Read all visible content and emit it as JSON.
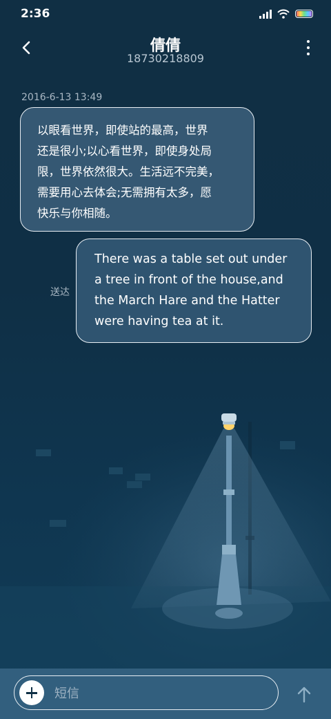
{
  "status_bar": {
    "time": "2:36",
    "icons": [
      "signal-icon",
      "wifi-icon",
      "battery-icon"
    ]
  },
  "header": {
    "back_icon": "chevron-left-icon",
    "contact_name": "倩倩",
    "contact_number": "18730218809",
    "menu_icon": "more-vertical-icon"
  },
  "conversation": {
    "timestamp": "2016-6-13 13:49",
    "messages": [
      {
        "direction": "incoming",
        "lines": [
          "以眼看世界，即使站的最高，世界",
          "还是很小;以心看世界，即使身处局",
          "限，世界依然很大。生活远不完美，",
          "需要用心去体会;无需拥有太多，愿",
          "快乐与你相随。"
        ]
      },
      {
        "direction": "outgoing",
        "lines": [
          "There was a table set out under",
          "a tree in front of the house,and",
          "the March Hare and the Hatter",
          "were having tea at it."
        ],
        "status": "送达"
      }
    ]
  },
  "composer": {
    "add_icon": "plus-icon",
    "placeholder": "短信",
    "send_icon": "arrow-up-icon"
  },
  "colors": {
    "background": "#0f2f45",
    "bubble": "#355873",
    "bottom_bar": "#325f7e"
  }
}
